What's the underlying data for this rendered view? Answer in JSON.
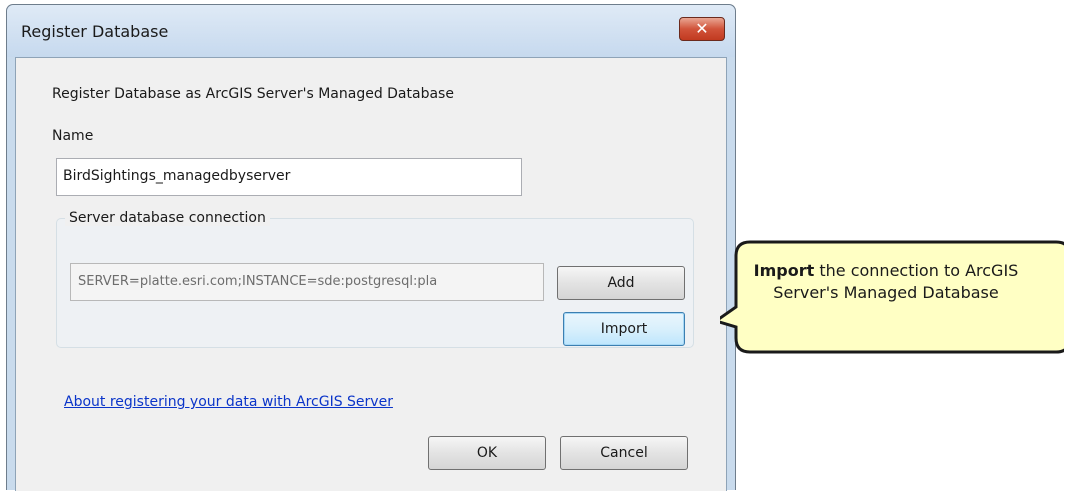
{
  "window": {
    "title": "Register Database",
    "close_label": "✕"
  },
  "dialog": {
    "heading": "Register Database as ArcGIS Server's Managed Database",
    "name_label": "Name",
    "name_value": "BirdSightings_managedbyserver",
    "group_label": "Server database connection",
    "connection_value": "SERVER=platte.esri.com;INSTANCE=sde:postgresql:pla",
    "add_label": "Add",
    "import_label": "Import",
    "help_link": "About registering your data with ArcGIS Server",
    "ok_label": "OK",
    "cancel_label": "Cancel"
  },
  "callout": {
    "bold": "Import",
    "rest": " the connection to ArcGIS Server's Managed Database"
  },
  "colors": {
    "callout_fill": "#ffffc4",
    "callout_border": "#1a1a1a",
    "link": "#0b35c9",
    "close_button": "#c13a20"
  }
}
